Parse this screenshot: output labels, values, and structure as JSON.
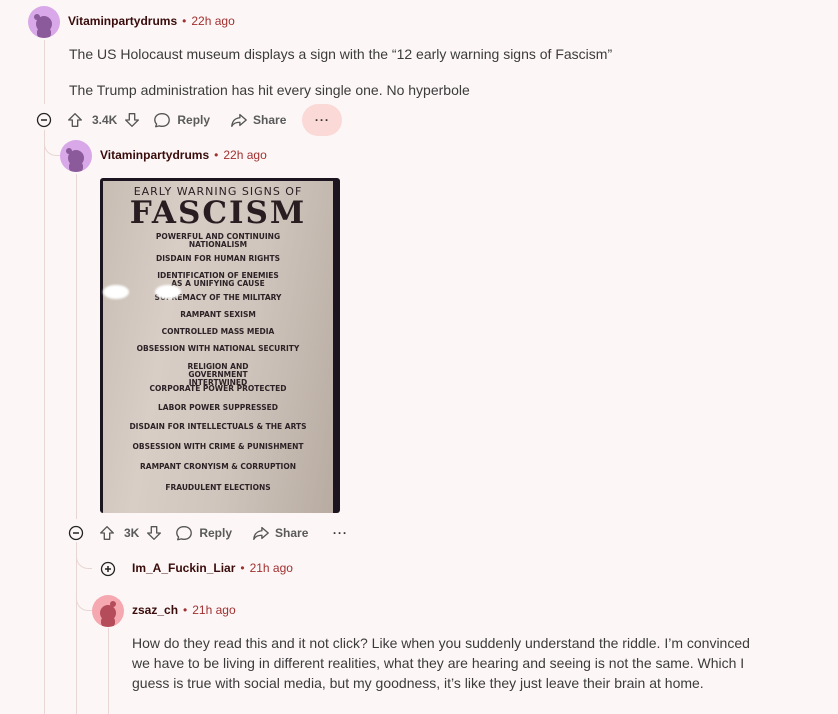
{
  "comments": [
    {
      "username": "Vitaminpartydrums",
      "time": "22h ago",
      "paragraphs": [
        "The US Holocaust museum displays a sign with the “12 early warning signs of Fascism”",
        "The Trump administration has hit every single one. No hyperbole"
      ],
      "score": "3.4K",
      "reply_label": "Reply",
      "share_label": "Share",
      "more_label": "···",
      "avatar_color": "#c89bd9"
    },
    {
      "username": "Vitaminpartydrums",
      "time": "22h ago",
      "score": "3K",
      "reply_label": "Reply",
      "share_label": "Share",
      "more_label": "···",
      "image": {
        "heading_small": "EARLY WARNING SIGNS OF",
        "heading_big": "FASCISM",
        "items": [
          "POWERFUL AND CONTINUING NATIONALISM",
          "DISDAIN FOR HUMAN RIGHTS",
          "IDENTIFICATION OF ENEMIES AS A UNIFYING CAUSE",
          "SUPREMACY OF THE MILITARY",
          "RAMPANT SEXISM",
          "CONTROLLED MASS MEDIA",
          "OBSESSION WITH NATIONAL SECURITY",
          "RELIGION AND GOVERNMENT INTERTWINED",
          "CORPORATE POWER PROTECTED",
          "LABOR POWER SUPPRESSED",
          "DISDAIN FOR INTELLECTUALS & THE ARTS",
          "OBSESSION WITH CRIME & PUNISHMENT",
          "RAMPANT CRONYISM & CORRUPTION",
          "FRAUDULENT ELECTIONS"
        ]
      }
    },
    {
      "username": "Im_A_Fuckin_Liar",
      "time": "21h ago",
      "collapsed": true
    },
    {
      "username": "zsaz_ch",
      "time": "21h ago",
      "text": "How do they read this and it not click? Like when you suddenly understand the riddle. I’m convinced we have to be living in different realities, what they are hearing and seeing is not the same. Which I guess is true with social media, but my goodness, it’s like they just leave their brain at home.",
      "avatar_color": "#f0a0a8"
    }
  ],
  "colors": {
    "background": "#fcf7f6",
    "username": "#3a0b0b",
    "timestamp": "#a13030",
    "more_hover": "#fbd9d7",
    "thread_line": "#e8d6d4"
  },
  "icons": [
    "collapse-icon",
    "expand-icon",
    "upvote-icon",
    "downvote-icon",
    "reply-icon",
    "share-icon",
    "more-icon",
    "snoo-avatar-icon"
  ]
}
